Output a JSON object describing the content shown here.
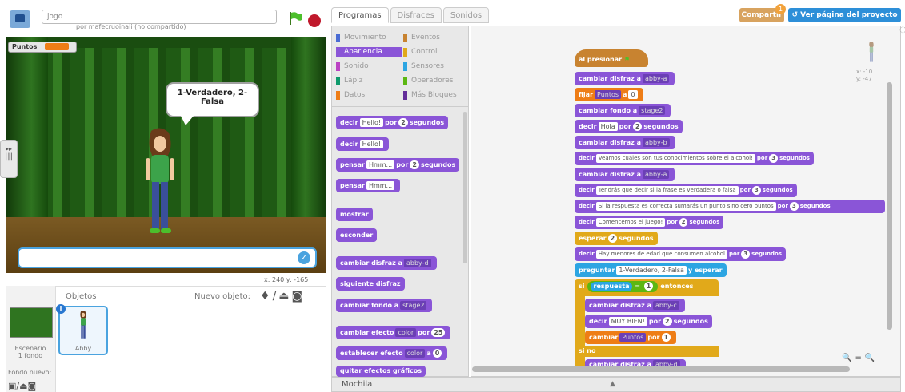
{
  "project": {
    "title": "jogo",
    "owner_line": "por mafecruoinali (no compartido)"
  },
  "stage": {
    "variable_name": "Puntos",
    "speech": "1-Verdadero, 2-Falsa",
    "coords": "x: 240  y: -165",
    "ask_check": "✓"
  },
  "sprites_pane": {
    "header": "Objetos",
    "new_object": "Nuevo objeto:",
    "stage_label": "Escenario",
    "stage_sub": "1 fondo",
    "sprite_name": "Abby",
    "backdrop_label": "Fondo nuevo:",
    "info_badge": "i"
  },
  "tabs": [
    "Programas",
    "Disfraces",
    "Sonidos"
  ],
  "header_buttons": {
    "share": "Compartir",
    "share_badge": "1",
    "see_page": "Ver página del proyecto"
  },
  "categories": [
    {
      "label": "Movimiento",
      "color": "#4a6cd4"
    },
    {
      "label": "Apariencia",
      "color": "#8a55d7",
      "active": true
    },
    {
      "label": "Sonido",
      "color": "#bb42c3"
    },
    {
      "label": "Lápiz",
      "color": "#0e9a6c"
    },
    {
      "label": "Datos",
      "color": "#ee7d16"
    },
    {
      "label": "Eventos",
      "color": "#c88330"
    },
    {
      "label": "Control",
      "color": "#e1a91a"
    },
    {
      "label": "Sensores",
      "color": "#2ca5e2"
    },
    {
      "label": "Operadores",
      "color": "#5cb712"
    },
    {
      "label": "Más Bloques",
      "color": "#632d99"
    }
  ],
  "palette_blocks": {
    "say_for": {
      "a": "decir",
      "slot": "Hello!",
      "b": "por",
      "num": "2",
      "c": "segundos"
    },
    "say": {
      "a": "decir",
      "slot": "Hello!"
    },
    "think_for": {
      "a": "pensar",
      "slot": "Hmm...",
      "b": "por",
      "num": "2",
      "c": "segundos"
    },
    "think": {
      "a": "pensar",
      "slot": "Hmm..."
    },
    "show": "mostrar",
    "hide": "esconder",
    "switch_costume": {
      "a": "cambiar disfraz a",
      "drop": "abby-d"
    },
    "next_costume": "siguiente disfraz",
    "switch_backdrop": {
      "a": "cambiar fondo a",
      "drop": "stage2"
    },
    "change_effect": {
      "a": "cambiar efecto",
      "drop": "color",
      "b": "por",
      "num": "25"
    },
    "set_effect": {
      "a": "establecer efecto",
      "drop": "color",
      "b": "a",
      "num": "0"
    },
    "clear_effects": "quitar efectos gráficos"
  },
  "script": {
    "hat": "al presionar",
    "b1": {
      "a": "cambiar disfraz a",
      "drop": "abby-a"
    },
    "b2": {
      "a": "fijar",
      "drop": "Puntos",
      "b": "a",
      "num": "0"
    },
    "b3": {
      "a": "cambiar fondo a",
      "drop": "stage2"
    },
    "b4": {
      "a": "decir",
      "slot": "Hola",
      "b": "por",
      "num": "2",
      "c": "segundos"
    },
    "b5": {
      "a": "cambiar disfraz a",
      "drop": "abby-b"
    },
    "b6": {
      "a": "decir",
      "slot": "Veamos cuáles son tus conocimientos sobre el alcohol!",
      "b": "por",
      "num": "3",
      "c": "segundos"
    },
    "b7": {
      "a": "cambiar disfraz a",
      "drop": "abby-a"
    },
    "b8": {
      "a": "decir",
      "slot": "Tendrás que decir si la frase es verdadera o falsa",
      "b": "por",
      "num": "3",
      "c": "segundos"
    },
    "b9": {
      "a": "decir",
      "slot": "Si la respuesta es correcta sumarás un punto sino cero puntos",
      "b": "por",
      "num": "3",
      "c": "segundos"
    },
    "b10": {
      "a": "decir",
      "slot": "Comencemos el juego!",
      "b": "por",
      "num": "2",
      "c": "segundos"
    },
    "b11": {
      "a": "esperar",
      "num": "2",
      "b": "segundos"
    },
    "b12": {
      "a": "decir",
      "slot": "Hay menores de edad que consumen alcohol",
      "b": "por",
      "num": "3",
      "c": "segundos"
    },
    "b13": {
      "a": "preguntar",
      "slot": "1-Verdadero, 2-Falsa",
      "b": "y esperar"
    },
    "b14": {
      "a": "si",
      "op_a": "respuesta",
      "op_eq": "=",
      "op_num": "1",
      "b": "entonces"
    },
    "b15": {
      "a": "cambiar disfraz a",
      "drop": "abby-c"
    },
    "b16": {
      "a": "decir",
      "slot": "MUY BIEN!",
      "b": "por",
      "num": "2",
      "c": "segundos"
    },
    "b17": {
      "a": "cambiar",
      "drop": "Puntos",
      "b": "por",
      "num": "1"
    },
    "b18": "si no",
    "b19": {
      "a": "cambiar disfraz a",
      "drop": "abby-d"
    }
  },
  "sprite_coords": {
    "x": "x: -10",
    "y": "y: -47"
  },
  "zoom_controls": "🔍 = 🔍",
  "backpack": "Mochila"
}
